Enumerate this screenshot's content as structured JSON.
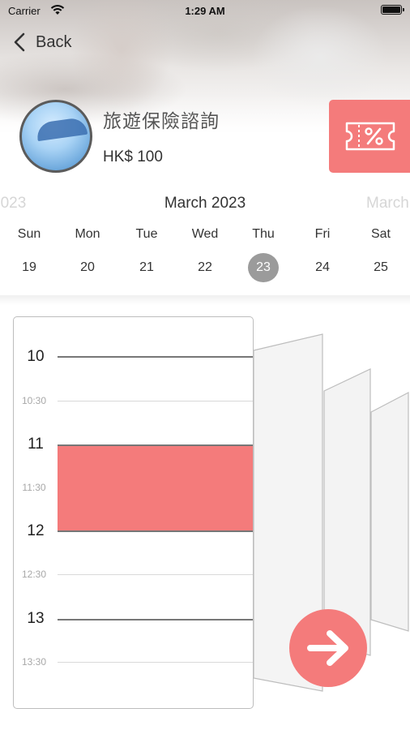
{
  "status_bar": {
    "carrier": "Carrier",
    "time": "1:29 AM"
  },
  "nav": {
    "back_label": "Back"
  },
  "product": {
    "title": "旅遊保險諮詢",
    "price": "HK$ 100",
    "coupon_icon": "coupon-percent-icon"
  },
  "calendar": {
    "prev_month": "2023",
    "current_month": "March 2023",
    "next_month": "March",
    "weekdays": [
      "Sun",
      "Mon",
      "Tue",
      "Wed",
      "Thu",
      "Fri",
      "Sat"
    ],
    "dates": [
      "19",
      "20",
      "21",
      "22",
      "23",
      "24",
      "25"
    ],
    "selected_date": "23"
  },
  "schedule": {
    "slots": [
      {
        "hour": "10",
        "half": "10:30"
      },
      {
        "hour": "11",
        "half": "11:30"
      },
      {
        "hour": "12",
        "half": "12:30"
      },
      {
        "hour": "13",
        "half": "13:30"
      }
    ],
    "booked": {
      "start": "11",
      "end": "12"
    }
  },
  "colors": {
    "accent": "#f47b7b",
    "selected_date": "#9b9b9b",
    "line": "#777777"
  },
  "next_icon": "arrow-right-icon"
}
